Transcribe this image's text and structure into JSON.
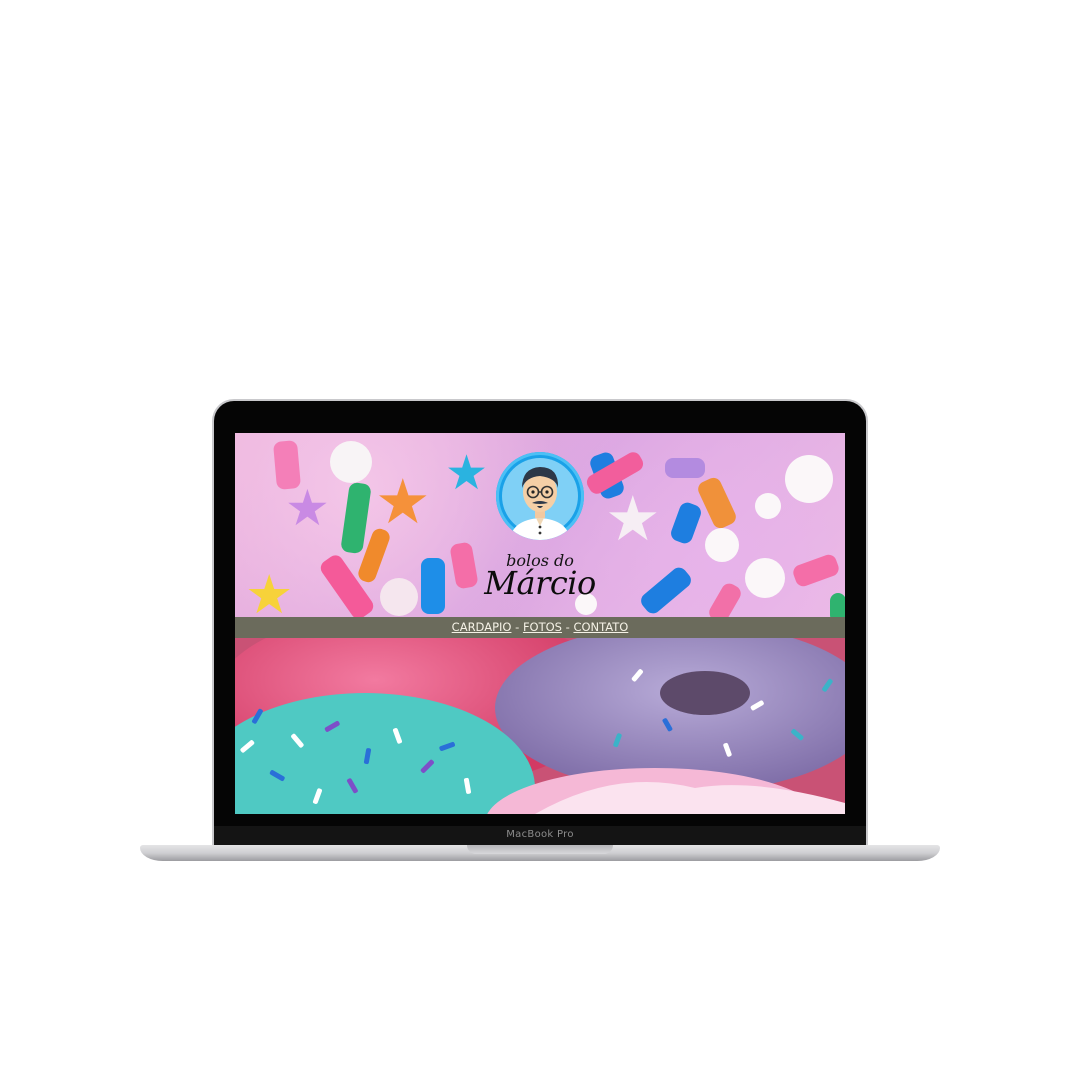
{
  "device": {
    "model_label": "MacBook Pro"
  },
  "site": {
    "brand_small": "bolos do",
    "brand_big": "Márcio",
    "nav": {
      "items": [
        {
          "label": "CARDAPIO"
        },
        {
          "label": "FOTOS"
        },
        {
          "label": "CONTATO"
        }
      ],
      "separator": "-"
    },
    "colors": {
      "nav_background": "#6b6b5c",
      "nav_text": "#f5f2e6",
      "logo_badge": "#1aa1e8"
    }
  }
}
